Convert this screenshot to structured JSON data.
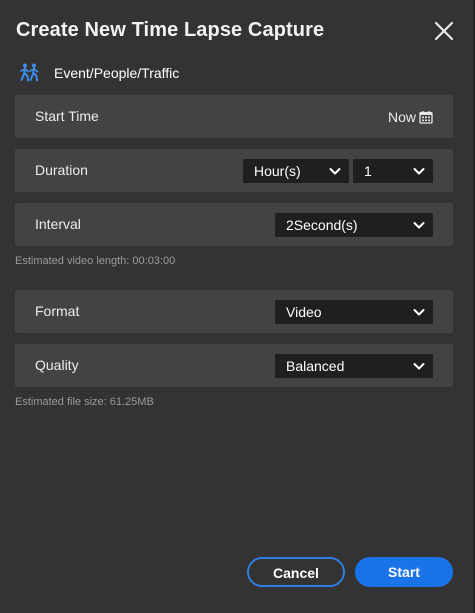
{
  "dialog": {
    "title": "Create New Time Lapse Capture",
    "close_icon": "close-icon"
  },
  "category": {
    "icon": "people-walking-icon",
    "label": "Event/People/Traffic",
    "icon_color": "#3d8ee8"
  },
  "start_time": {
    "label": "Start Time",
    "value": "Now",
    "icon": "calendar-icon"
  },
  "duration": {
    "label": "Duration",
    "unit_value": "Hour(s)",
    "amount_value": "1"
  },
  "interval": {
    "label": "Interval",
    "value": "2Second(s)"
  },
  "estimated_video_length": "Estimated video length: 00:03:00",
  "format": {
    "label": "Format",
    "value": "Video"
  },
  "quality": {
    "label": "Quality",
    "value": "Balanced"
  },
  "estimated_file_size": "Estimated file size: 61.25MB",
  "buttons": {
    "cancel": "Cancel",
    "start": "Start"
  },
  "colors": {
    "accent": "#1a73e8",
    "dialog_bg": "#333333",
    "row_bg": "#434343",
    "select_bg": "#1f1f1f"
  }
}
